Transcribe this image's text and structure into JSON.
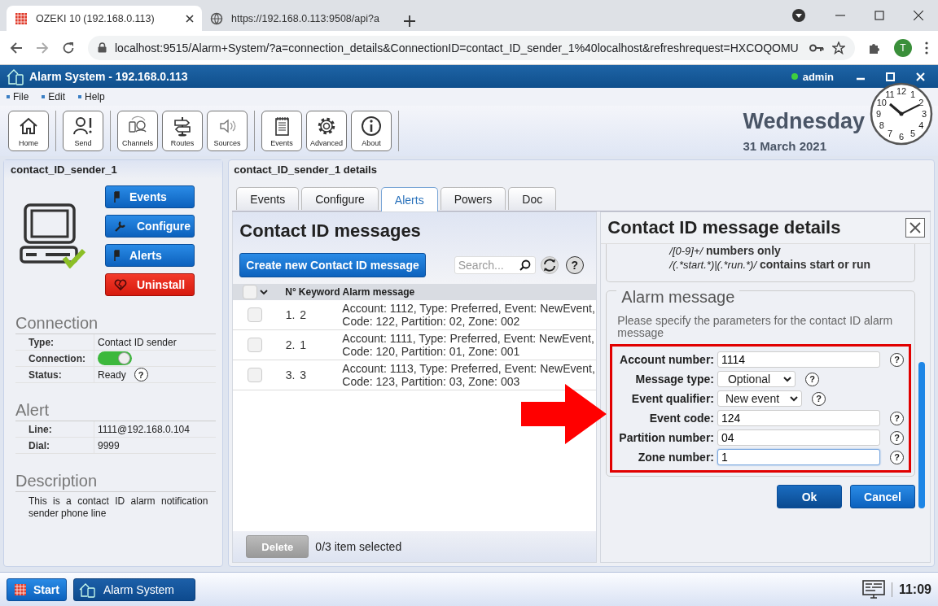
{
  "browser": {
    "tabs": [
      {
        "title": "OZEKI 10 (192.168.0.113)",
        "selected": true
      },
      {
        "title": "https://192.168.0.113:9508/api?a",
        "selected": false
      }
    ],
    "url": "localhost:9515/Alarm+System/?a=connection_details&ConnectionID=contact_ID_sender_1%40localhost&refreshrequest=HXCOQOMU",
    "profile": "T"
  },
  "app": {
    "title": "Alarm System - 192.168.0.113",
    "user": "admin",
    "user_online": true
  },
  "menu": [
    "File",
    "Edit",
    "Help"
  ],
  "toolbar": [
    [
      {
        "label": "Home"
      }
    ],
    [
      {
        "label": "Send"
      }
    ],
    [
      {
        "label": "Channels"
      },
      {
        "label": "Routes"
      },
      {
        "label": "Sources"
      }
    ],
    [
      {
        "label": "Events"
      },
      {
        "label": "Advanced"
      },
      {
        "label": "About"
      }
    ]
  ],
  "date": {
    "day": "Wednesday",
    "date": "31 March 2021"
  },
  "clock": {
    "numbers": [
      "12",
      "11",
      "1",
      "10",
      "2",
      "9",
      "3",
      "8",
      "4",
      "7",
      "5",
      "6"
    ]
  },
  "connection_panel": {
    "title": "contact_ID_sender_1",
    "actions": [
      {
        "label": "Events",
        "kind": "primary"
      },
      {
        "label": "Configure",
        "kind": "primary"
      },
      {
        "label": "Alerts",
        "kind": "primary"
      },
      {
        "label": "Uninstall",
        "kind": "danger"
      }
    ],
    "sections": [
      {
        "heading": "Connection",
        "rows": [
          {
            "label": "Type:",
            "kind": "text",
            "value": "Contact ID sender"
          },
          {
            "label": "Connection:",
            "kind": "toggle",
            "on": true
          },
          {
            "label": "Status:",
            "kind": "status",
            "value": "Ready",
            "help": "?"
          }
        ]
      },
      {
        "heading": "Alert",
        "rows": [
          {
            "label": "Line:",
            "kind": "text",
            "value": "1111@192.168.0.104"
          },
          {
            "label": "Dial:",
            "kind": "text",
            "value": "9999"
          }
        ]
      }
    ],
    "description_heading": "Description",
    "description": "This is a contact ID alarm notification sender phone line"
  },
  "details": {
    "title": "contact_ID_sender_1 details",
    "tabs": [
      {
        "label": "Events",
        "selected": false
      },
      {
        "label": "Configure",
        "selected": false
      },
      {
        "label": "Alerts",
        "selected": true
      },
      {
        "label": "Powers",
        "selected": false
      },
      {
        "label": "Doc",
        "selected": false
      }
    ]
  },
  "messages": {
    "title": "Contact ID messages",
    "create_button": "Create new Contact ID message",
    "search_placeholder": "Search...",
    "help": "?",
    "select_all_checked": false,
    "columns": [
      "N°",
      "Keyword",
      "Alarm message"
    ],
    "rows": [
      {
        "number": "1.",
        "keyword": "2",
        "message": "Account: 1112, Type: Preferred, Event: NewEvent, Code: 122, Partition: 02, Zone: 002",
        "checked": false
      },
      {
        "number": "2.",
        "keyword": "1",
        "message": "Account: 1111, Type: Preferred, Event: NewEvent, Code: 120, Partition: 01, Zone: 001",
        "checked": false
      },
      {
        "number": "3.",
        "keyword": "3",
        "message": "Account: 1113, Type: Preferred, Event: NewEvent, Code: 123, Partition: 03, Zone: 003",
        "checked": false
      }
    ],
    "delete_button": {
      "label": "Delete",
      "disabled": true
    },
    "selection_info": "0/3 item selected"
  },
  "dialog": {
    "title": "Contact ID message details",
    "hints": [
      {
        "pattern": "/[0-9]+/",
        "meaning": "numbers only"
      },
      {
        "pattern": "/(.*start.*)|(.*run.*)/",
        "meaning": "contains start or run"
      }
    ],
    "legend": "Alarm message",
    "description": "Please specify the parameters for the contact ID alarm message",
    "fields": [
      {
        "label": "Account number:",
        "kind": "text",
        "value": "1114",
        "focused": false,
        "help": "?"
      },
      {
        "label": "Message type:",
        "kind": "select",
        "value": "Optional",
        "focused": false,
        "help": "?"
      },
      {
        "label": "Event qualifier:",
        "kind": "select",
        "value": "New event",
        "focused": false,
        "help": "?"
      },
      {
        "label": "Event code:",
        "kind": "text",
        "value": "124",
        "focused": false,
        "help": "?"
      },
      {
        "label": "Partition number:",
        "kind": "text",
        "value": "04",
        "focused": false,
        "help": "?"
      },
      {
        "label": "Zone number:",
        "kind": "text",
        "value": "1",
        "focused": true,
        "help": "?"
      }
    ],
    "buttons": [
      {
        "label": "Ok",
        "focused": true
      },
      {
        "label": "Cancel",
        "focused": false
      }
    ]
  },
  "annotations": {
    "arrow": true,
    "highlight_fields": true
  },
  "taskbar": {
    "start": "Start",
    "apps": [
      {
        "label": "Alarm System",
        "selected": true
      }
    ],
    "time": "11:09"
  }
}
